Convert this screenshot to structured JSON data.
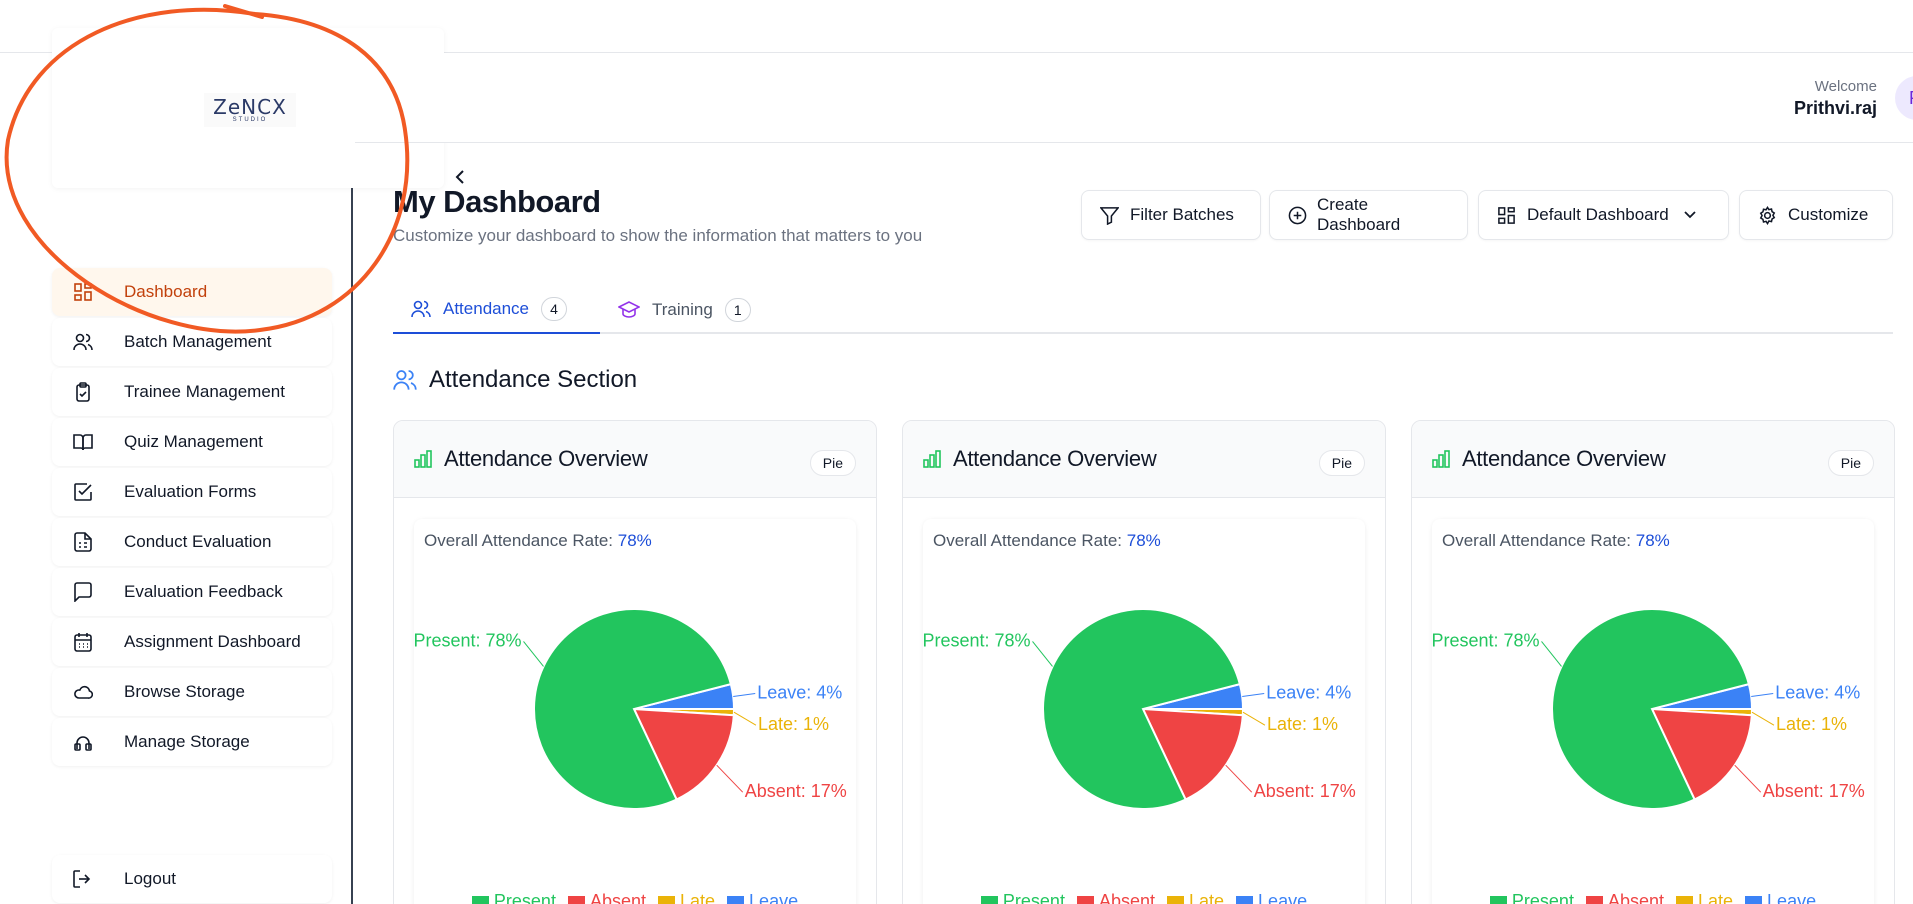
{
  "header": {
    "welcome_label": "Welcome",
    "user_name": "Prithvi.raj",
    "avatar_initial": "P"
  },
  "logo": {
    "main": "ZeNCX",
    "sub": "STUDIO"
  },
  "sidebar": {
    "items": [
      {
        "label": "Dashboard",
        "icon": "grid-icon",
        "active": true
      },
      {
        "label": "Batch Management",
        "icon": "users-icon"
      },
      {
        "label": "Trainee Management",
        "icon": "clipboard-icon"
      },
      {
        "label": "Quiz Management",
        "icon": "book-icon"
      },
      {
        "label": "Evaluation Forms",
        "icon": "check-square-icon"
      },
      {
        "label": "Conduct Evaluation",
        "icon": "sheet-icon"
      },
      {
        "label": "Evaluation Feedback",
        "icon": "message-icon"
      },
      {
        "label": "Assignment Dashboard",
        "icon": "calendar-icon"
      },
      {
        "label": "Browse Storage",
        "icon": "cloud-icon"
      },
      {
        "label": "Manage Storage",
        "icon": "storage-icon"
      }
    ],
    "logout_label": "Logout"
  },
  "page": {
    "title": "My Dashboard",
    "subtitle": "Customize your dashboard to show the information that matters to you"
  },
  "toolbar": {
    "filter_label": "Filter Batches",
    "create_label": "Create Dashboard",
    "default_label": "Default Dashboard",
    "customize_label": "Customize"
  },
  "tabs": [
    {
      "label": "Attendance",
      "count": "4",
      "active": true
    },
    {
      "label": "Training",
      "count": "1"
    }
  ],
  "section": {
    "title": "Attendance Section"
  },
  "colors": {
    "present": "#22c55e",
    "absent": "#ef4444",
    "late": "#eab308",
    "leave": "#3b82f6",
    "annotation": "#f15a24"
  },
  "cards": [
    {
      "title": "Attendance Overview",
      "badge": "Pie",
      "rate_label": "Overall Attendance Rate:",
      "rate_value": "78%"
    },
    {
      "title": "Attendance Overview",
      "badge": "Pie",
      "rate_label": "Overall Attendance Rate:",
      "rate_value": "78%"
    },
    {
      "title": "Attendance Overview",
      "badge": "Pie",
      "rate_label": "Overall Attendance Rate:",
      "rate_value": "78%"
    }
  ],
  "chart_data": [
    {
      "type": "pie",
      "slices": [
        {
          "name": "Present",
          "value": 78,
          "label": "Present: 78%"
        },
        {
          "name": "Absent",
          "value": 17,
          "label": "Absent: 17%"
        },
        {
          "name": "Late",
          "value": 1,
          "label": "Late: 1%"
        },
        {
          "name": "Leave",
          "value": 4,
          "label": "Leave: 4%"
        }
      ],
      "legend": [
        "Present",
        "Absent",
        "Late",
        "Leave"
      ],
      "legend_position": "bottom"
    },
    {
      "type": "pie",
      "slices": [
        {
          "name": "Present",
          "value": 78,
          "label": "Present: 78%"
        },
        {
          "name": "Absent",
          "value": 17,
          "label": "Absent: 17%"
        },
        {
          "name": "Late",
          "value": 1,
          "label": "Late: 1%"
        },
        {
          "name": "Leave",
          "value": 4,
          "label": "Leave: 4%"
        }
      ],
      "legend": [
        "Present",
        "Absent",
        "Late",
        "Leave"
      ],
      "legend_position": "bottom"
    },
    {
      "type": "pie",
      "slices": [
        {
          "name": "Present",
          "value": 78,
          "label": "Present: 78%"
        },
        {
          "name": "Absent",
          "value": 17,
          "label": "Absent: 17%"
        },
        {
          "name": "Late",
          "value": 1,
          "label": "Late: 1%"
        },
        {
          "name": "Leave",
          "value": 4,
          "label": "Leave: 4%"
        }
      ],
      "legend": [
        "Present",
        "Absent",
        "Late",
        "Leave"
      ],
      "legend_position": "bottom"
    }
  ]
}
